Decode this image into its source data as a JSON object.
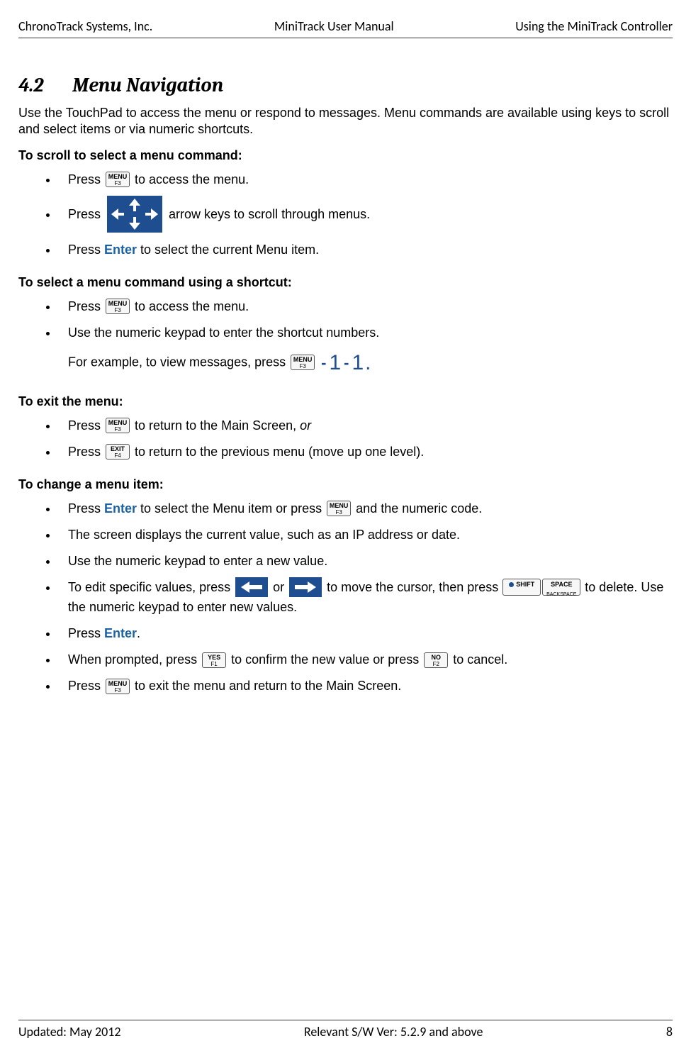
{
  "header": {
    "left": "ChronoTrack Systems, Inc.",
    "center": "MiniTrack User Manual",
    "right": "Using the MiniTrack Controller"
  },
  "footer": {
    "left": "Updated: May 2012",
    "center": "Relevant S/W Ver: 5.2.9 and above",
    "right": "8"
  },
  "section": {
    "number": "4.2",
    "title": "Menu Navigation"
  },
  "intro": "Use the TouchPad to access the menu or respond to messages.  Menu commands are available using keys to scroll and select items or via numeric shortcuts.",
  "keys": {
    "menu_top": "MENU",
    "menu_bot": "F3",
    "exit_top": "EXIT",
    "exit_bot": "F4",
    "yes_top": "YES",
    "yes_bot": "F1",
    "no_top": "NO",
    "no_bot": "F2",
    "shift": "SHIFT",
    "space": "SPACE",
    "backspace": "BACKSPACE",
    "enter": "Enter"
  },
  "headings": {
    "scroll": "To scroll to select a menu command:",
    "shortcut": "To select a menu command using a shortcut:",
    "exit": "To exit the menu:",
    "change": "To change a menu item:"
  },
  "bullets": {
    "s1a_pre": "Press ",
    "s1a_post": " to access the menu.",
    "s1b_pre": "Press ",
    "s1b_post": " arrow keys to scroll through menus.",
    "s1c_a": "Press ",
    "s1c_b": " to select the current Menu item.",
    "s2a_pre": "Press ",
    "s2a_post": " to access the menu.",
    "s2b": "Use the numeric keypad to enter the shortcut numbers.",
    "s2b_sub_pre": "For example, to view messages, press ",
    "s3a_pre": "Press ",
    "s3a_post": " to return to the Main Screen, ",
    "s3a_or": "or",
    "s3b_pre": "Press ",
    "s3b_post": " to return to the previous menu (move up one level).",
    "s4a_a": "Press ",
    "s4a_b": " to select the Menu item or press ",
    "s4a_c": " and the numeric code.",
    "s4b": "The screen displays the current value, such as an IP address or date.",
    "s4c": "Use the numeric keypad to enter a new value.",
    "s4d_a": "To edit specific values, press ",
    "s4d_b": " or ",
    "s4d_c": " to move the cursor, then press ",
    "s4d_d": " to delete. Use the numeric keypad to enter new values.",
    "s4e_a": "Press ",
    "s4e_b": ".",
    "s4f_a": "When prompted, press ",
    "s4f_b": " to confirm the new value or press ",
    "s4f_c": " to cancel.",
    "s4g_a": "Press  ",
    "s4g_b": " to exit the menu and return to the Main Screen."
  },
  "seq": {
    "n1": "1",
    "n2": "1"
  }
}
